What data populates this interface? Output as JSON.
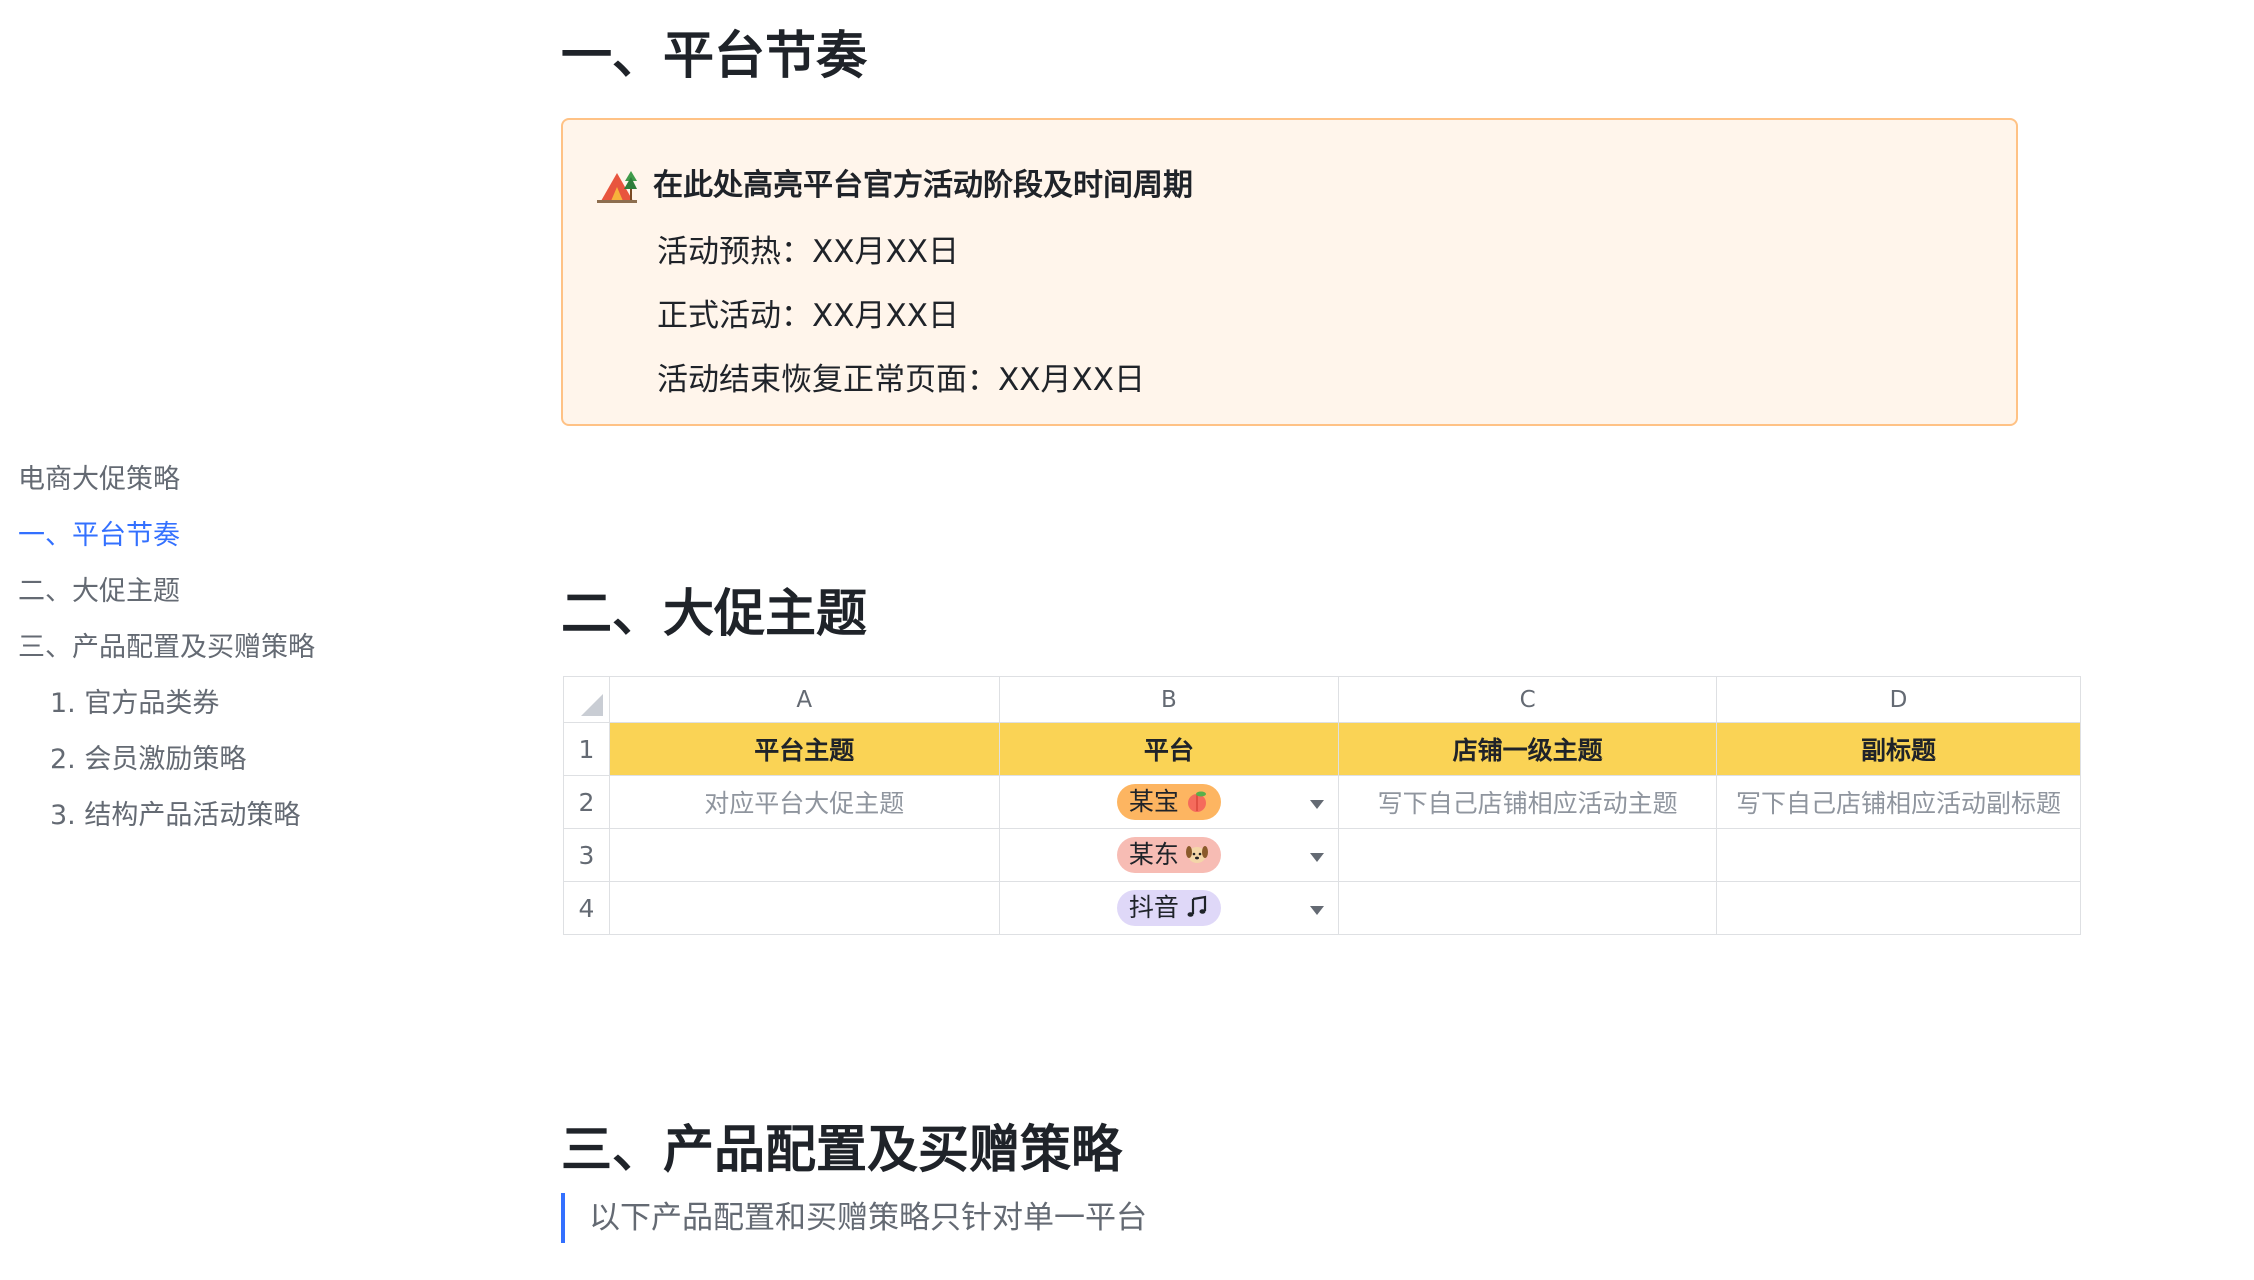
{
  "toc": {
    "title": "电商大促策略",
    "items": [
      {
        "label": "一、平台节奏"
      },
      {
        "label": "二、大促主题"
      },
      {
        "label": "三、产品配置及买赠策略"
      },
      {
        "label": "1. 官方品类券"
      },
      {
        "label": "2. 会员激励策略"
      },
      {
        "label": "3. 结构产品活动策略"
      }
    ]
  },
  "section1": {
    "heading": "一、平台节奏",
    "callout": {
      "icon": "camping-tent-icon",
      "title": "在此处高亮平台官方活动阶段及时间周期",
      "lines": [
        "活动预热：XX月XX日",
        "正式活动：XX月XX日",
        "活动结束恢复正常页面：XX月XX日"
      ]
    }
  },
  "section2": {
    "heading": "二、大促主题",
    "sheet": {
      "columns": [
        "A",
        "B",
        "C",
        "D"
      ],
      "rows": [
        "1",
        "2",
        "3",
        "4"
      ],
      "header": [
        "平台主题",
        "平台",
        "店铺一级主题",
        "副标题"
      ],
      "row2": {
        "a": "对应平台大促主题",
        "c": "写下自己店铺相应活动主题",
        "d": "写下自己店铺相应活动副标题"
      },
      "platforms": [
        {
          "label": "某宝",
          "icon": "peach-icon",
          "color": "#fdb561"
        },
        {
          "label": "某东",
          "icon": "dog-face-icon",
          "color": "#f7bcb4"
        },
        {
          "label": "抖音",
          "icon": "music-note-icon",
          "color": "#dfd8f8"
        }
      ],
      "header_color": "#fad355"
    }
  },
  "section3": {
    "heading": "三、产品配置及买赠策略",
    "quote": "以下产品配置和买赠策略只针对单一平台"
  },
  "colors": {
    "accent": "#3370ff",
    "callout_bg": "#fff5eb",
    "callout_border": "#ffc285"
  }
}
